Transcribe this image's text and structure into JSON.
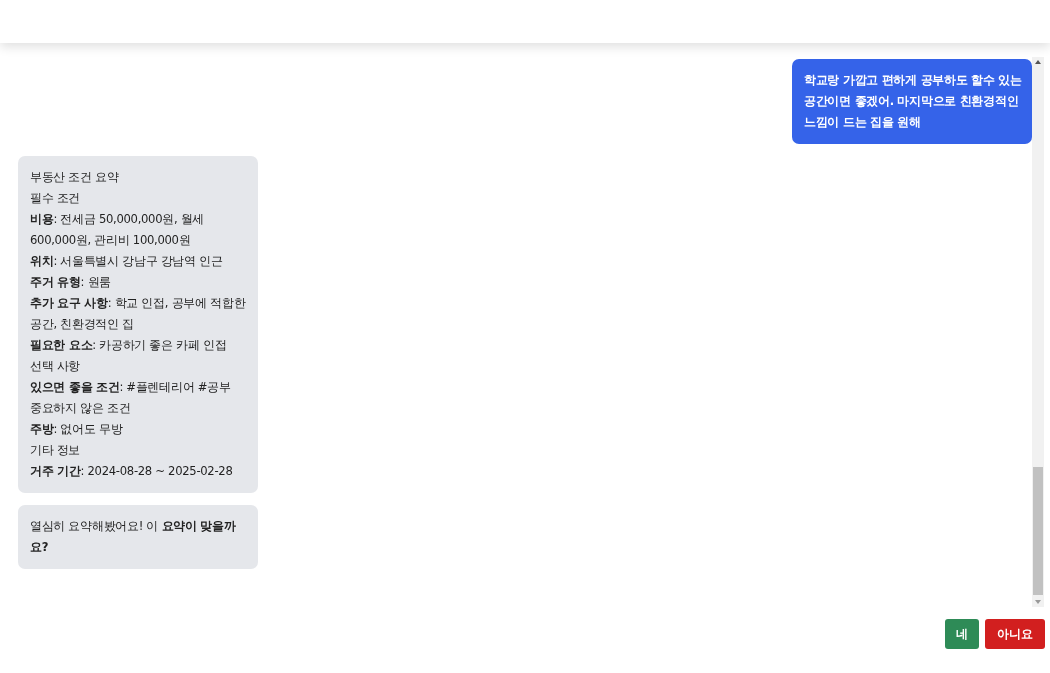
{
  "messages": [
    {
      "kind": "user",
      "lines": [
        "학교랑 가깝고 편하게 공부하도 할수 있는 공간이면 좋겠어. 마지막으로 친환경적인 느낌이 드는 집을 원해"
      ]
    },
    {
      "kind": "bot",
      "lines": [
        "부동산 조건 요약",
        "필수 조건",
        "**비용**: 전세금 50,000,000원, 월세 600,000원, 관리비 100,000원",
        "**위치**: 서울특별시 강남구 강남역 인근",
        "**주거 유형**: 원룸",
        "**추가 요구 사항**: 학교 인접, 공부에 적합한 공간, 친환경적인 집",
        "**필요한 요소**: 카공하기 좋은 카페 인접",
        "선택 사항",
        "**있으면 좋을 조건**: #플렌테리어 #공부",
        "중요하지 않은 조건",
        "**주방**: 없어도 무방",
        "기타 정보",
        "**거주 기간**: 2024-08-28 ~ 2025-02-28"
      ]
    },
    {
      "kind": "bot",
      "lines": [
        "열심히 요약해봤어요! 이 **요약이 맞을까요?**"
      ]
    }
  ],
  "buttons": [
    {
      "label": "네",
      "kind": "confirm"
    },
    {
      "label": "아니요",
      "kind": "cancel"
    }
  ]
}
